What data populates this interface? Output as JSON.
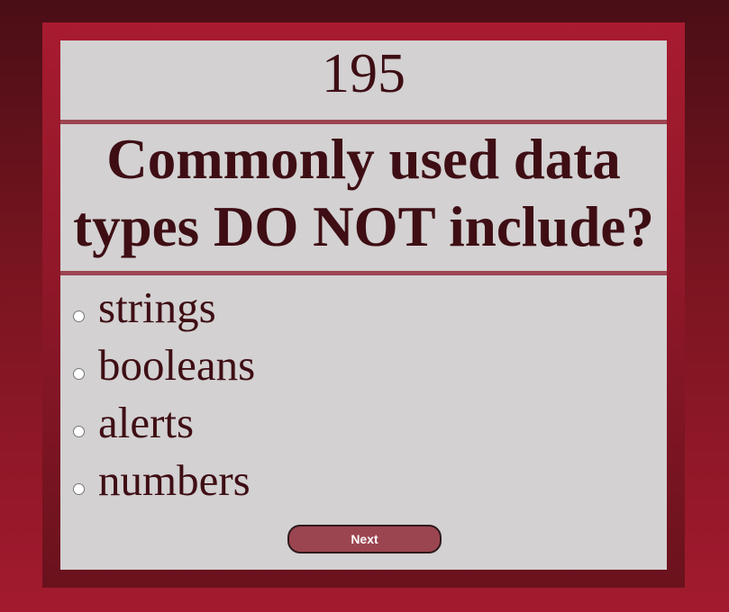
{
  "quiz": {
    "timer": "195",
    "question": "Commonly used data types DO NOT include?",
    "choices": [
      {
        "label": "strings"
      },
      {
        "label": "booleans"
      },
      {
        "label": "alerts"
      },
      {
        "label": "numbers"
      }
    ],
    "next_label": "Next"
  },
  "colors": {
    "background_dark": "#4a0e16",
    "background_light": "#a31a2e",
    "frame": "#8c1727",
    "panel": "#d3d1d2",
    "text": "#3e0e14",
    "divider": "#9c4551",
    "button": "#9b4550"
  }
}
